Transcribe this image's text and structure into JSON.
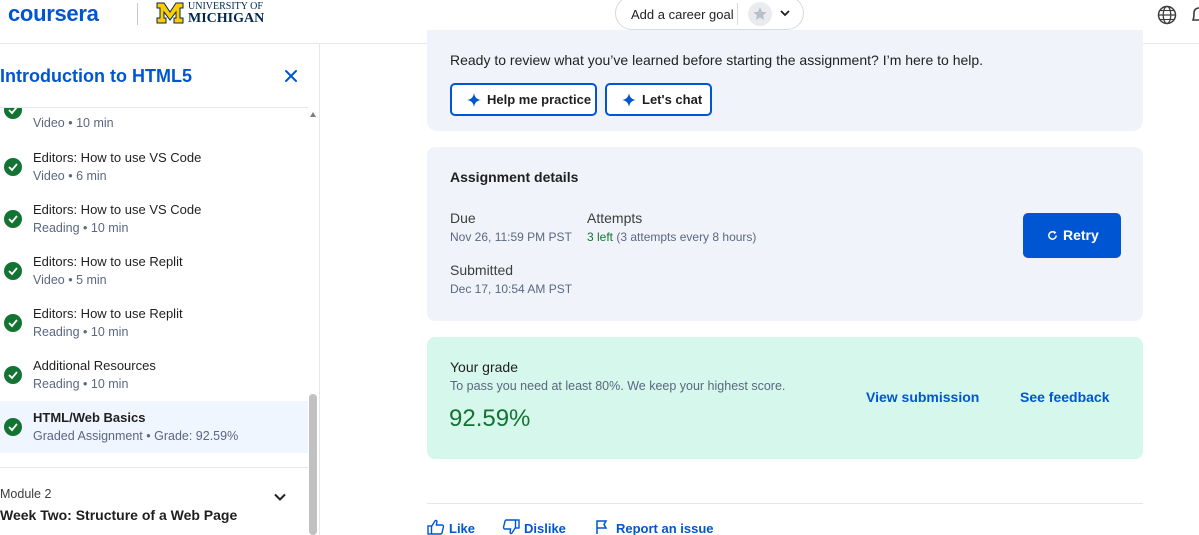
{
  "header": {
    "logo_text": "coursera",
    "partner_line1": "UNIVERSITY OF",
    "partner_line2": "MICHIGAN",
    "career_goal_label": "Add a career goal",
    "icons": [
      "star-icon",
      "chevron-down-icon",
      "globe-icon",
      "bell-icon"
    ]
  },
  "sidebar": {
    "course_title": "Introduction to HTML5",
    "items": [
      {
        "title": "",
        "sub": "Video • 10 min",
        "completed": true
      },
      {
        "title": "Editors: How to use VS Code",
        "sub": "Video • 6 min",
        "completed": true
      },
      {
        "title": "Editors: How to use VS Code",
        "sub": "Reading • 10 min",
        "completed": true
      },
      {
        "title": "Editors: How to use Replit",
        "sub": "Video • 5 min",
        "completed": true
      },
      {
        "title": "Editors: How to use Replit",
        "sub": "Reading • 10 min",
        "completed": true
      },
      {
        "title": "Additional Resources",
        "sub": "Reading • 10 min",
        "completed": true
      },
      {
        "title": "HTML/Web Basics",
        "sub": "Graded Assignment • Grade: 92.59%",
        "completed": true,
        "active": true
      }
    ],
    "module": {
      "label": "Module 2",
      "title": "Week Two: Structure of a Web Page"
    }
  },
  "coach": {
    "message": "Ready to review what you’ve learned before starting the assignment? I’m here to help.",
    "practice_label": "Help me practice",
    "chat_label": "Let's chat"
  },
  "assignment": {
    "title": "Assignment details",
    "due_label": "Due",
    "due_value": "Nov 26, 11:59 PM PST",
    "attempts_label": "Attempts",
    "attempts_left": "3 left",
    "attempts_detail": "(3 attempts every 8 hours)",
    "submitted_label": "Submitted",
    "submitted_value": "Dec 17, 10:54 AM PST",
    "retry_label": "Retry"
  },
  "grade": {
    "title": "Your grade",
    "description": "To pass you need at least 80%. We keep your highest score.",
    "value": "92.59%",
    "view_submission": "View submission",
    "see_feedback": "See feedback"
  },
  "feedback": {
    "like": "Like",
    "dislike": "Dislike",
    "report": "Report an issue"
  },
  "colors": {
    "brand_blue": "#0056d2",
    "success_green": "#137333",
    "card_bg": "#f0f4fa",
    "grade_bg": "#d6f7ec"
  }
}
